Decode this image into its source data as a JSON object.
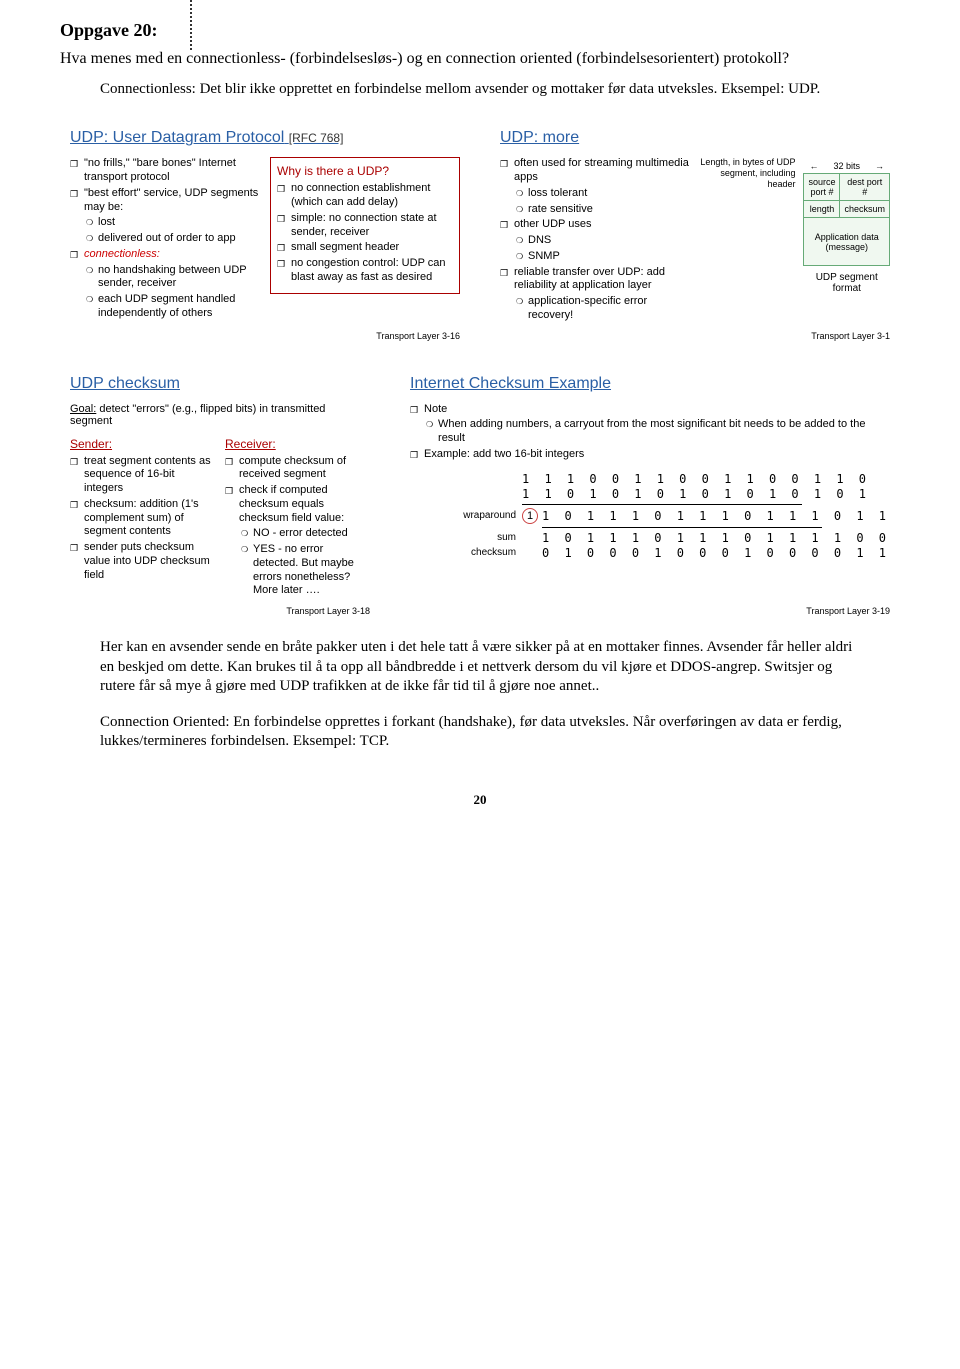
{
  "task": {
    "header": "Oppgave 20:",
    "question": "Hva menes med en connectionless- (forbindelsesløs-) og en connection oriented (forbindelsesorientert) protokoll?",
    "answer_top": "Connectionless: Det blir ikke opprettet en forbindelse mellom avsender og mottaker før data utveksles. Eksempel: UDP.",
    "answer_mid1": "Her kan en avsender sende en bråte pakker uten i det hele tatt å være sikker på at en mottaker finnes. Avsender får heller aldri en beskjed om dette. Kan brukes til å ta opp all båndbredde i et nettverk dersom du vil kjøre et DDOS-angrep. Switsjer og rutere får så mye å gjøre med UDP trafikken at de ikke får tid til å gjøre noe annet..",
    "answer_mid2": "Connection Oriented: En forbindelse opprettes i forkant (handshake), før data utveksles. Når overføringen av data er ferdig, lukkes/termineres forbindelsen. Eksempel: TCP."
  },
  "slide1": {
    "title": "UDP: User Datagram Protocol",
    "ref": "[RFC 768]",
    "left": {
      "l1": "\"no frills,\" \"bare bones\" Internet transport protocol",
      "l2": "\"best effort\" service, UDP segments may be:",
      "l2a": "lost",
      "l2b": "delivered out of order to app",
      "l3": "connectionless:",
      "l3a": "no handshaking between UDP sender, receiver",
      "l3b": "each UDP segment handled independently of others"
    },
    "why": {
      "title": "Why is there a UDP?",
      "w1": "no connection establishment (which can add delay)",
      "w2": "simple: no connection state at sender, receiver",
      "w3": "small segment header",
      "w4": "no congestion control: UDP can blast away as fast as desired"
    },
    "footer": "Transport Layer   3-16"
  },
  "slide2": {
    "title": "UDP: more",
    "left": {
      "l1": "often used for streaming multimedia apps",
      "l1a": "loss tolerant",
      "l1b": "rate sensitive",
      "l2": "other UDP uses",
      "l2a": "DNS",
      "l2b": "SNMP",
      "l3": "reliable transfer over UDP: add reliability at application layer",
      "l3a": "application-specific error recovery!"
    },
    "seg": {
      "bits": "32 bits",
      "len_label": "Length, in bytes of UDP segment, including header",
      "sp": "source port #",
      "dp": "dest port #",
      "len": "length",
      "ck": "checksum",
      "data": "Application data (message)",
      "caption": "UDP segment format"
    },
    "footer": "Transport Layer   3-1"
  },
  "slide3": {
    "title": "UDP checksum",
    "goal": "Goal: detect \"errors\" (e.g., flipped bits) in transmitted segment",
    "sender": {
      "label": "Sender:",
      "s1": "treat segment contents as sequence of 16-bit integers",
      "s2": "checksum: addition (1's complement sum) of segment contents",
      "s3": "sender puts checksum value into UDP checksum field"
    },
    "receiver": {
      "label": "Receiver:",
      "r1": "compute checksum of received segment",
      "r2": "check if computed checksum equals checksum field value:",
      "r2a": "NO - error detected",
      "r2b": "YES - no error detected. But maybe errors nonetheless? More later …."
    },
    "footer": "Transport Layer   3-18"
  },
  "slide4": {
    "title": "Internet Checksum Example",
    "note_label": "Note",
    "note": "When adding numbers, a carryout from the most significant bit needs to be added to the result",
    "example_label": "Example: add two 16-bit integers",
    "bin": {
      "r1": "1 1 1 0 0 1 1 0 0 1 1 0 0 1 1 0",
      "r2": "1 1 0 1 0 1 0 1 0 1 0 1 0 1 0 1",
      "wrap_label": "wraparound",
      "wrap1": "1",
      "r3": "1 0 1 1 1 0 1 1 1 0 1 1 1 0 1 1",
      "sum_label": "sum",
      "r4": "1 0 1 1 1 0 1 1 1 0 1 1 1 1 0 0",
      "ck_label": "checksum",
      "r5": "0 1 0 0 0 1 0 0 0 1 0 0 0 0 1 1"
    },
    "footer": "Transport Layer   3-19"
  },
  "page_number": "20"
}
